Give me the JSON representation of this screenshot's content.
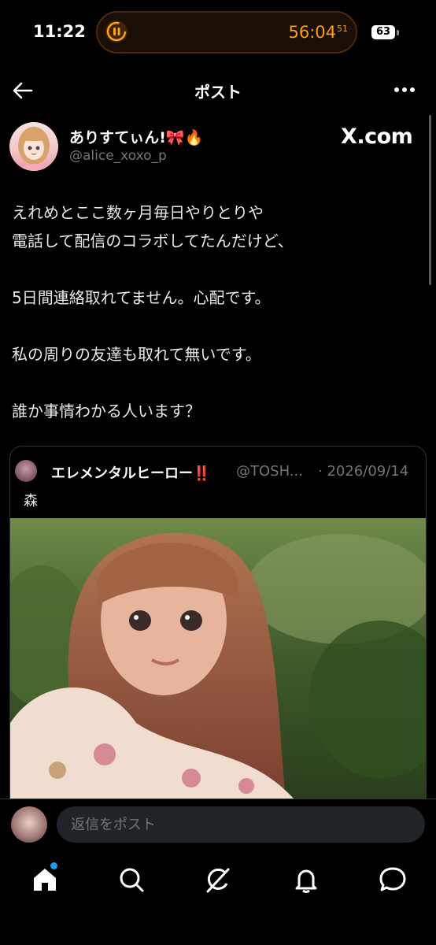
{
  "status_bar": {
    "time": "11:22",
    "timer": "56:04",
    "timer_seconds": "51",
    "battery": "63",
    "timer_color": "#ff9f0a"
  },
  "header": {
    "title": "ポスト",
    "back_icon": "back-arrow-icon",
    "more_icon": "more-icon"
  },
  "post": {
    "author_name": "ありすてぃん!🎀🔥",
    "author_handle": "@alice_xoxo_p",
    "watermark": "X.com",
    "lines": [
      "えれめとここ数ヶ月毎日やりとりや",
      "電話して配信のコラボしてたんだけど、",
      "",
      "5日間連絡取れてません。心配です。",
      "",
      "私の周りの友達も取れて無いです。",
      "",
      "誰か事情わかる人います？"
    ]
  },
  "quote": {
    "author_name": "エレメンタルヒーロー‼️",
    "author_handle": "@TOSH...",
    "date": "· 2026/09/14",
    "text": "森"
  },
  "reply": {
    "placeholder": "返信をポスト"
  },
  "tab_bar": {
    "items": [
      {
        "icon": "home-icon",
        "active": true
      },
      {
        "icon": "search-icon",
        "active": false
      },
      {
        "icon": "grok-icon",
        "active": false
      },
      {
        "icon": "notifications-icon",
        "active": false
      },
      {
        "icon": "messages-icon",
        "active": false
      }
    ],
    "accent": "#1d9bf0"
  }
}
